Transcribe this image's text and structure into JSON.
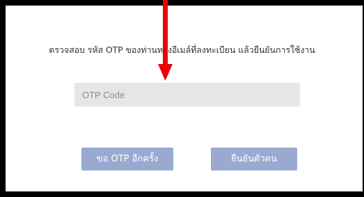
{
  "instruction": "ตรวจสอบ รหัส OTP ของท่านทางอีเมล์ที่ลงทะเบียน แล้วยืนยันการใช้งาน",
  "otp_input": {
    "placeholder": "OTP Code",
    "value": ""
  },
  "buttons": {
    "resend_label": "ขอ OTP อีกครั้ง",
    "confirm_label": "ยืนยันตัวตน"
  },
  "colors": {
    "button_bg": "#9aa9cf",
    "input_bg": "#e6e6e6",
    "arrow": "#ee0000",
    "frame_border": "#000000"
  },
  "icons": [
    "red-arrow-annotation"
  ]
}
